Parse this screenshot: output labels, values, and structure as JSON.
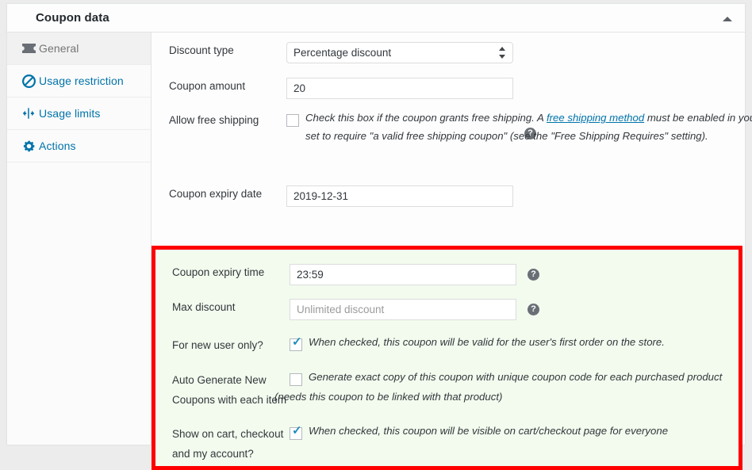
{
  "panel": {
    "title": "Coupon data",
    "collapse_icon": "triangle-up-icon"
  },
  "sidebar": {
    "items": [
      {
        "label": "General",
        "icon": "ticket-icon",
        "active": true
      },
      {
        "label": "Usage restriction",
        "icon": "prohibited-icon",
        "active": false
      },
      {
        "label": "Usage limits",
        "icon": "limits-icon",
        "active": false
      },
      {
        "label": "Actions",
        "icon": "gear-icon",
        "active": false
      }
    ]
  },
  "form": {
    "discount_type": {
      "label": "Discount type",
      "value": "Percentage discount",
      "options": [
        "Percentage discount"
      ]
    },
    "coupon_amount": {
      "label": "Coupon amount",
      "value": "20",
      "help": "?"
    },
    "allow_free_shipping": {
      "label": "Allow free shipping",
      "checked": false,
      "desc_part1": "Check this box if the coupon grants free shipping. A ",
      "desc_link": "free shipping method",
      "desc_part2": " must be enabled in your shipping zone and be set to require \"a valid free shipping coupon\" (see the \"Free Shipping Requires\" setting)."
    },
    "coupon_expiry_date": {
      "label": "Coupon expiry date",
      "value": "2019-12-31"
    },
    "coupon_expiry_time": {
      "label": "Coupon expiry time",
      "value": "23:59",
      "help": "?"
    },
    "max_discount": {
      "label": "Max discount",
      "value": "",
      "placeholder": "Unlimited discount",
      "help": "?"
    },
    "for_new_user_only": {
      "label": "For new user only?",
      "checked": true,
      "desc": "When checked, this coupon will be valid for the user's first order on the store."
    },
    "auto_generate_coupons": {
      "label_line1": "Auto Generate New",
      "label_line2": "Coupons with each item",
      "checked": false,
      "desc_line1": "Generate exact copy of this coupon with unique coupon code for each purchased product",
      "desc_line2": "(needs this coupon to be linked with that product)"
    },
    "show_on_cart": {
      "label_line1": "Show on cart, checkout",
      "label_line2": "and my account?",
      "checked": true,
      "desc": "When checked, this coupon will be visible on cart/checkout page for everyone"
    }
  },
  "colors": {
    "link": "#0073aa",
    "highlight_border": "#fe0000",
    "highlight_bg": "#f2fbee",
    "checkbox_tick": "#1e8cbe"
  }
}
